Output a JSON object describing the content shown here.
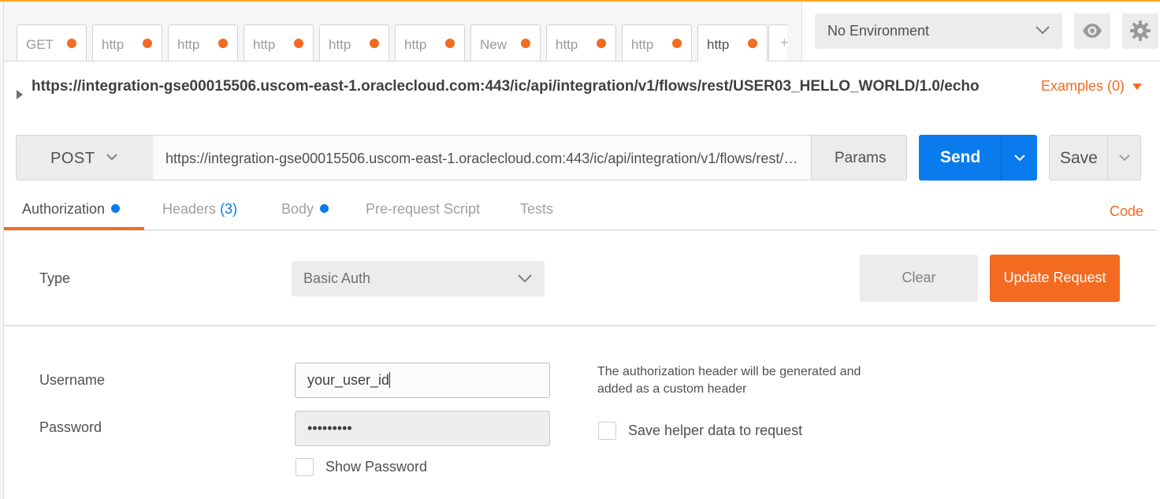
{
  "tabs": [
    {
      "label": "GET",
      "dot": true,
      "active": false
    },
    {
      "label": "http",
      "dot": true,
      "active": false
    },
    {
      "label": "http",
      "dot": true,
      "active": false
    },
    {
      "label": "http",
      "dot": true,
      "active": false
    },
    {
      "label": "http",
      "dot": true,
      "active": false
    },
    {
      "label": "http",
      "dot": true,
      "active": false
    },
    {
      "label": "New",
      "dot": true,
      "active": false
    },
    {
      "label": "http",
      "dot": true,
      "active": false
    },
    {
      "label": "http",
      "dot": true,
      "active": false
    },
    {
      "label": "http",
      "dot": true,
      "active": true
    }
  ],
  "tab_overflow_glyph": "+",
  "environment": {
    "selected": "No Environment"
  },
  "request": {
    "url_heading": "https://integration-gse00015506.uscom-east-1.oraclecloud.com:443/ic/api/integration/v1/flows/rest/USER03_HELLO_WORLD/1.0/echo",
    "examples_label": "Examples (0)",
    "method": "POST",
    "url": "https://integration-gse00015506.uscom-east-1.oraclecloud.com:443/ic/api/integration/v1/flows/rest/USER03_HELLO_WORLD/1.0/echo",
    "params_label": "Params",
    "send_label": "Send",
    "save_label": "Save"
  },
  "request_tabs": {
    "authorization": "Authorization",
    "headers": "Headers",
    "headers_count": "(3)",
    "body": "Body",
    "prerequest": "Pre-request Script",
    "tests": "Tests",
    "code": "Code"
  },
  "auth": {
    "type_label": "Type",
    "type_value": "Basic Auth",
    "clear_label": "Clear",
    "update_label": "Update Request",
    "username_label": "Username",
    "username_value": "your_user_id",
    "password_label": "Password",
    "password_value": "•••••••••",
    "show_password_label": "Show Password",
    "note": "The authorization header will be generated and added as a custom header",
    "save_helper_label": "Save helper data to request"
  },
  "colors": {
    "accent": "#f26b21",
    "primary": "#097bed"
  }
}
